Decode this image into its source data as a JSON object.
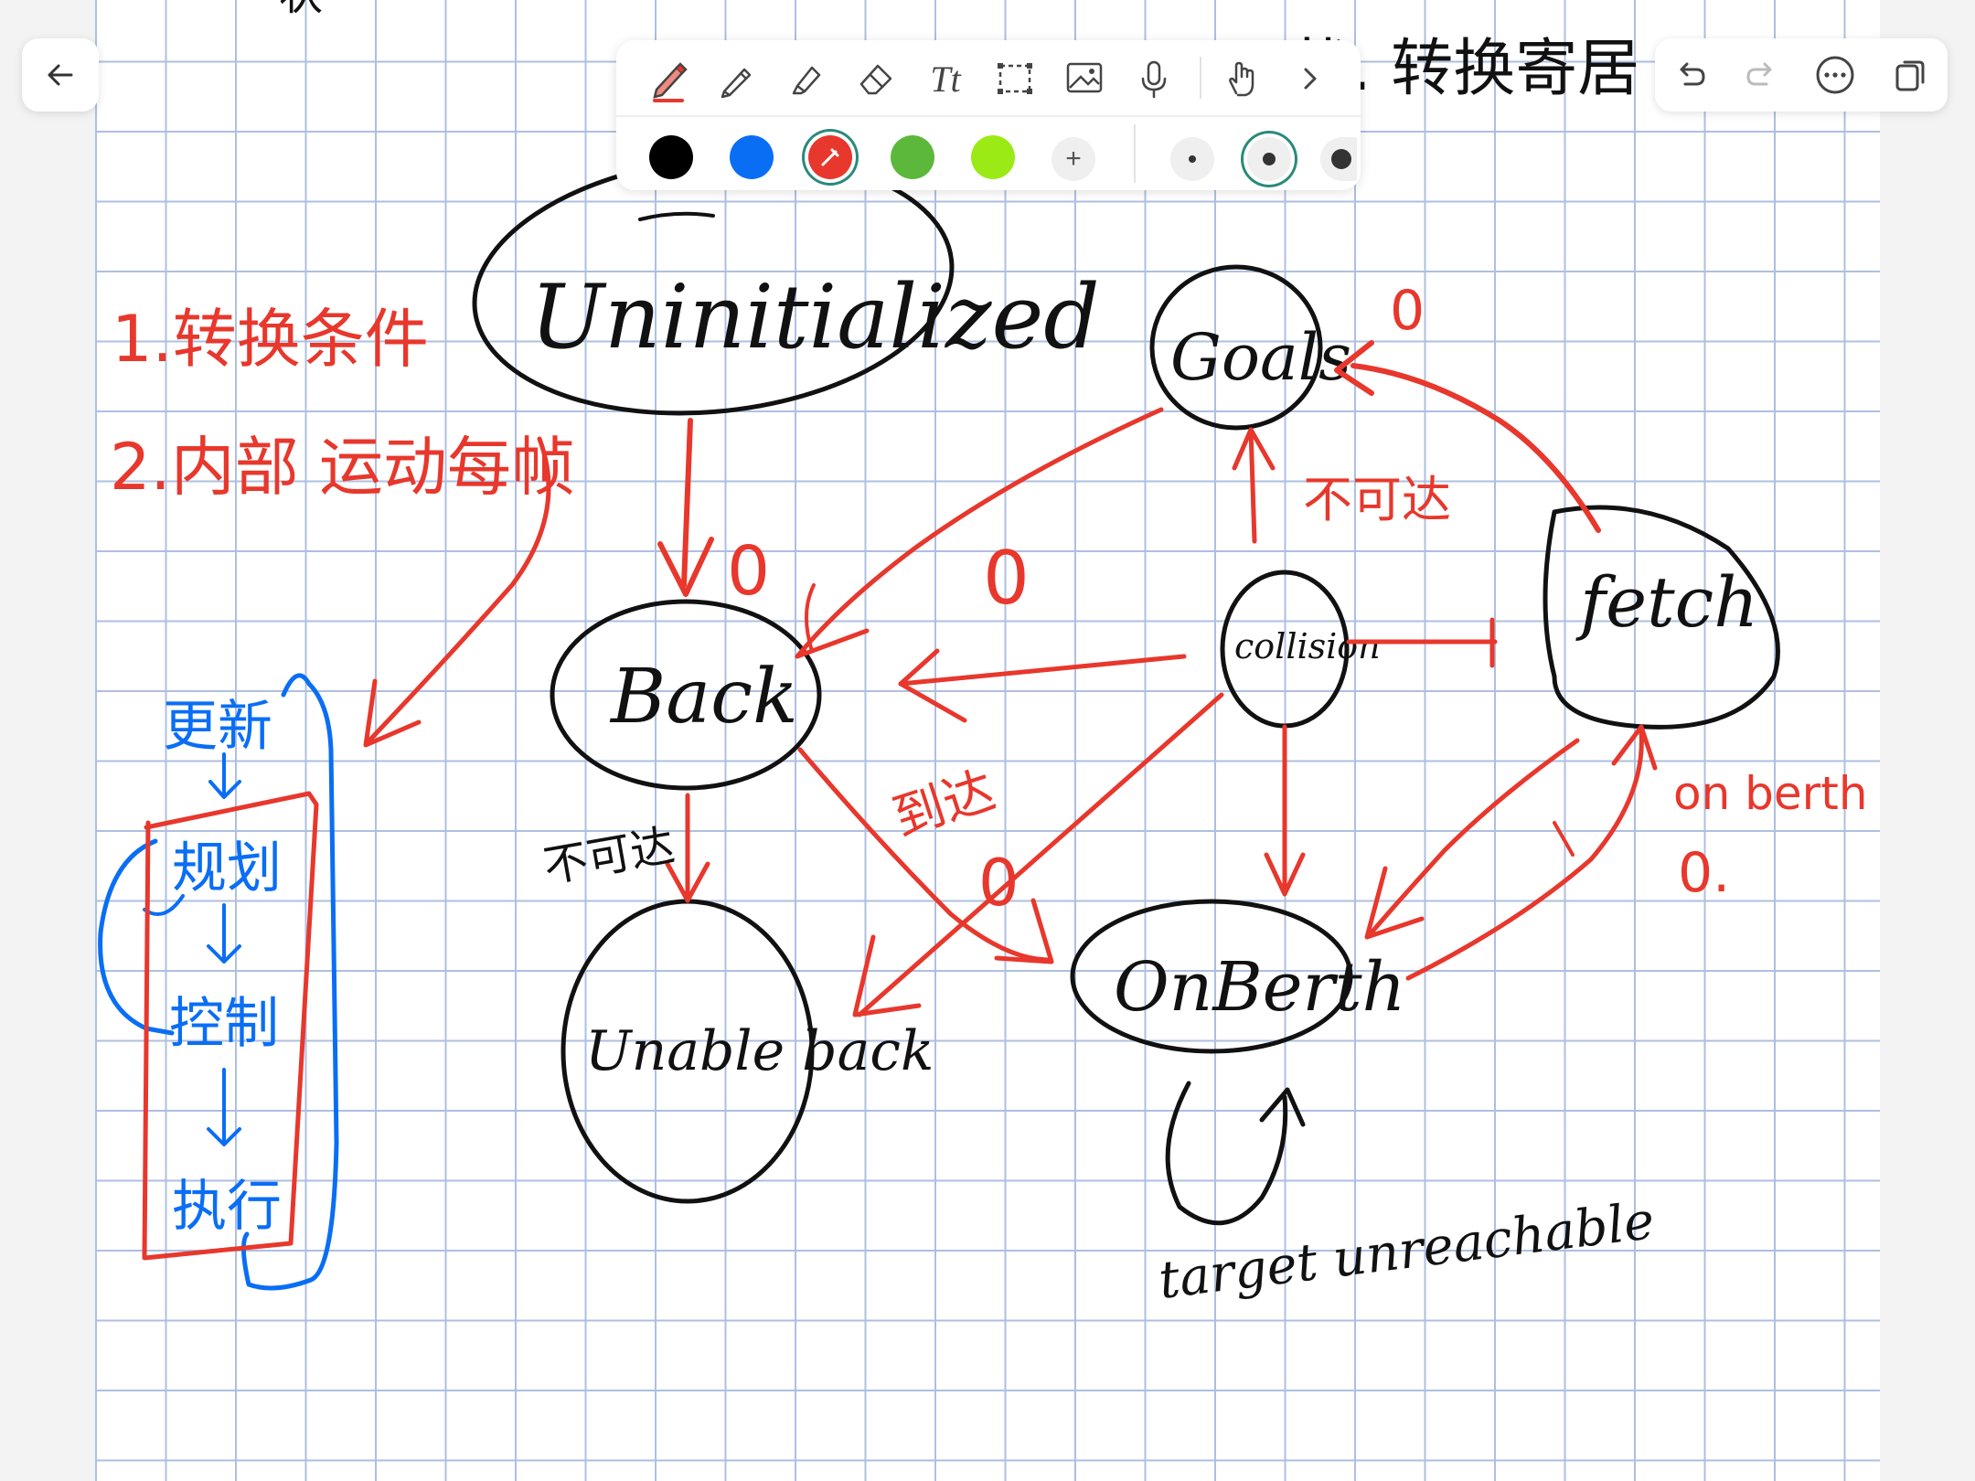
{
  "toolbar": {
    "tools": [
      "pen-icon",
      "pencil-icon",
      "highlighter-icon",
      "eraser-icon",
      "text-icon",
      "lasso-select-icon",
      "image-icon",
      "microphone-icon",
      "hand-touch-icon",
      "chevron-right-icon"
    ],
    "text_tool_label": "Tt",
    "active_tool": "pen",
    "colors": [
      {
        "name": "black",
        "hex": "#000000"
      },
      {
        "name": "blue",
        "hex": "#0a6ef5"
      },
      {
        "name": "red",
        "hex": "#e8372c",
        "selected": true
      },
      {
        "name": "green",
        "hex": "#5cb83a"
      },
      {
        "name": "lime",
        "hex": "#9bea16"
      }
    ],
    "add_color_label": "+",
    "pen_sizes": [
      "small",
      "medium",
      "large"
    ],
    "selected_size": "medium"
  },
  "nav": {
    "back": "arrow-left-icon",
    "actions": [
      "undo-icon",
      "redo-icon",
      "more-icon",
      "pages-icon"
    ]
  },
  "notes": {
    "top_left_fragment": "状",
    "top_right_fragment": "状. 转换寄居",
    "red_list": {
      "item1": "1.转换条件",
      "item2": "2.内部 运动每帧"
    },
    "blue_flow": [
      "更新",
      "规划",
      "控制",
      "执行"
    ],
    "states": {
      "uninitialized": "Uninitialized",
      "back": "Back",
      "unable_back": "Unable back",
      "goals": "Goals",
      "collision": "collision",
      "fetch": "fetch",
      "onberth": "OnBerth"
    },
    "edge_labels": {
      "uninit_to_back": "0",
      "back_to_unable": "不可达",
      "goals_to_back": "0",
      "goals_mark": "0",
      "collision_to_goals": "不可达",
      "back_to_onberth": "到达",
      "collision_to_unable": "0",
      "fetch_to_onberth": "on berth",
      "fetch_mark": "0."
    },
    "self_loop_label": "target unreachable"
  }
}
